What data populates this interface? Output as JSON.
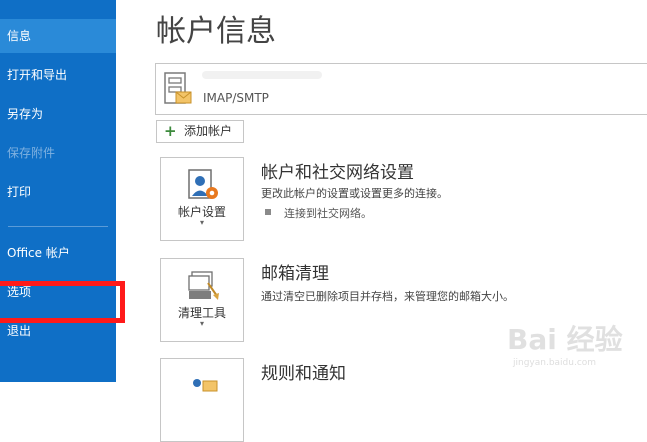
{
  "sidebar": {
    "items": [
      {
        "label": "信息",
        "selected": true,
        "disabled": false
      },
      {
        "label": "打开和导出",
        "selected": false,
        "disabled": false
      },
      {
        "label": "另存为",
        "selected": false,
        "disabled": false
      },
      {
        "label": "保存附件",
        "selected": false,
        "disabled": true
      },
      {
        "label": "打印",
        "selected": false,
        "disabled": false
      },
      {
        "label": "Office 帐户",
        "selected": false,
        "disabled": false
      },
      {
        "label": "选项",
        "selected": false,
        "disabled": false
      },
      {
        "label": "退出",
        "selected": false,
        "disabled": false
      }
    ],
    "highlighted_item": "选项"
  },
  "main": {
    "title": "帐户信息",
    "account": {
      "type": "IMAP/SMTP",
      "icon": "mail-account-icon"
    },
    "add_account_label": "添加帐户",
    "sections": [
      {
        "tile_label": "帐户设置",
        "tile_icon": "account-settings-icon",
        "title": "帐户和社交网络设置",
        "description": "更改此帐户的设置或设置更多的连接。",
        "bullets": [
          "连接到社交网络。"
        ]
      },
      {
        "tile_label": "清理工具",
        "tile_icon": "cleanup-tools-icon",
        "title": "邮箱清理",
        "description": "通过清空已删除项目并存档，来管理您的邮箱大小。",
        "bullets": []
      },
      {
        "tile_label": "",
        "tile_icon": "rules-alerts-icon",
        "title": "规则和通知",
        "description": "",
        "bullets": []
      }
    ]
  },
  "watermark": {
    "main": "Bai 经验",
    "sub": "jingyan.baidu.com"
  },
  "colors": {
    "sidebar_bg": "#0f6fc6",
    "sidebar_selected": "#2a8ad8",
    "highlight_box": "#ff1a1a"
  }
}
